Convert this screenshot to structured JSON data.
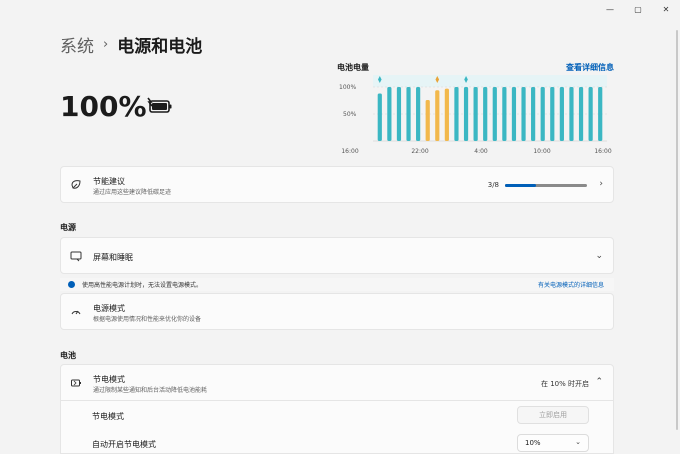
{
  "window": {
    "minimize": "—",
    "maximize": "▢",
    "close": "✕"
  },
  "breadcrumb": {
    "parent": "系统",
    "separator": "›",
    "current": "电源和电池"
  },
  "battery": {
    "percent": "100%"
  },
  "usage": {
    "title": "电池电量",
    "details_link": "查看详细信息"
  },
  "chart_data": {
    "type": "bar",
    "y_tick_labels": [
      "100%",
      "50%"
    ],
    "x_tick_labels": [
      "16:00",
      "22:00",
      "4:00",
      "10:00",
      "16:00"
    ],
    "ylim": [
      0,
      100
    ],
    "grid": true,
    "values": [
      88,
      100,
      100,
      100,
      100,
      76,
      94,
      97,
      100,
      100,
      100,
      100,
      100,
      100,
      100,
      100,
      100,
      100,
      100,
      100,
      100,
      100,
      100,
      100
    ],
    "charging": [
      false,
      false,
      false,
      false,
      false,
      true,
      true,
      true,
      false,
      false,
      false,
      false,
      false,
      false,
      false,
      false,
      false,
      false,
      false,
      false,
      false,
      false,
      false,
      false
    ],
    "colors": {
      "battery": "#3bb7c3",
      "charging": "#f2b84b",
      "marker": "#3bb7c3",
      "charge_marker": "#e8a43a"
    }
  },
  "energy_card": {
    "title": "节能建议",
    "subtitle": "通过应用这些建议降低碳足迹",
    "progress_text": "3/8",
    "progress": 0.375
  },
  "power_section": {
    "label": "电源"
  },
  "screen_sleep": {
    "title": "屏幕和睡眠"
  },
  "info_bar": {
    "text": "使用高性能电源计划时，无法设置电源模式。",
    "link": "有关电源模式的详细信息"
  },
  "power_mode": {
    "title": "电源模式",
    "subtitle": "根据电源使用情况和性能来优化你的设备"
  },
  "battery_section": {
    "label": "电池"
  },
  "saver_card": {
    "title": "节电模式",
    "subtitle": "通过限制某些通知和后台活动降低电池能耗",
    "status": "在 10% 时开启"
  },
  "saver_toggle_row": {
    "title": "节电模式",
    "button": "立即启用"
  },
  "auto_saver_row": {
    "title": "自动开启节电模式",
    "value": "10%"
  },
  "accent": "#005fb8"
}
